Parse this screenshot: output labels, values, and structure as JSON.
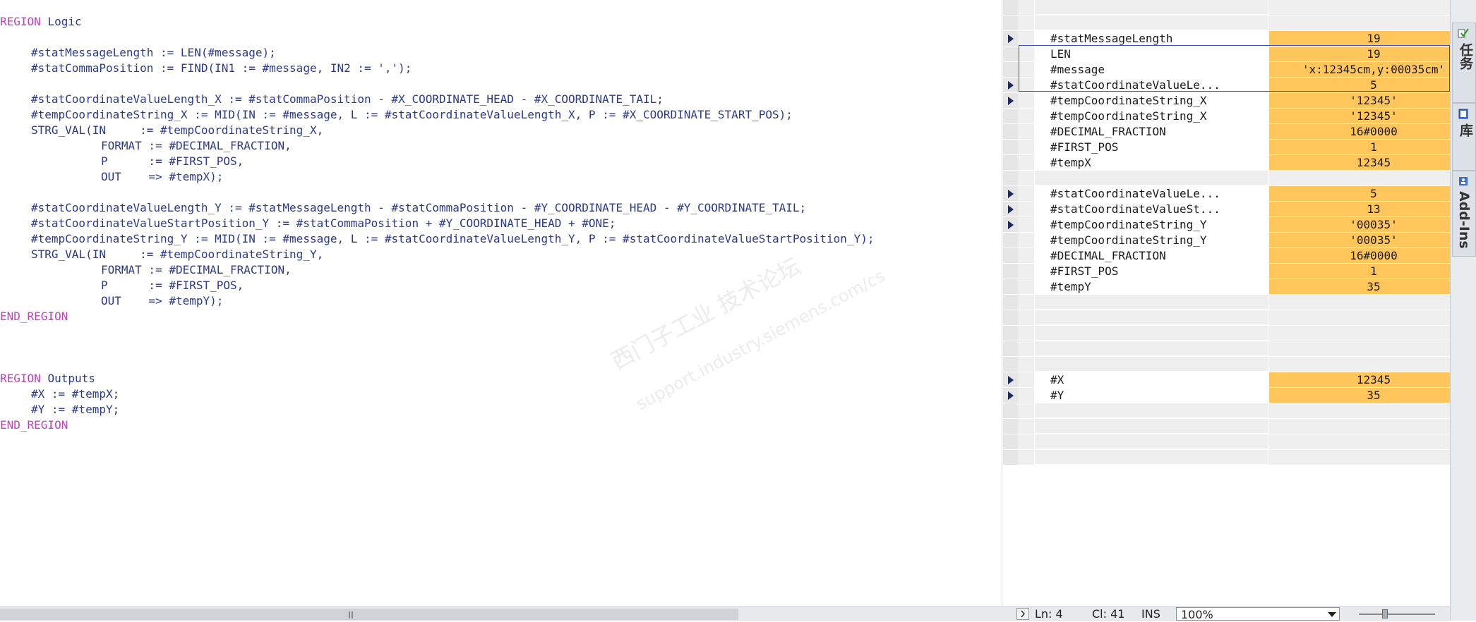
{
  "code": {
    "region_kw": "REGION",
    "end_region_kw": "END_REGION",
    "region_logic_name": "Logic",
    "region_outputs_name": "Outputs",
    "l_msg_len": "#statMessageLength := LEN(#message);",
    "l_comma_pos": "#statCommaPosition := FIND(IN1 := #message, IN2 := ',');",
    "l_cvl_x": "#statCoordinateValueLength_X := #statCommaPosition - #X_COORDINATE_HEAD - #X_COORDINATE_TAIL;",
    "l_tcs_x": "#tempCoordinateString_X := MID(IN := #message, L := #statCoordinateValueLength_X, P := #X_COORDINATE_START_POS);",
    "l_strg_x_1": "STRG_VAL(IN     := #tempCoordinateString_X,",
    "l_strg_x_2": "FORMAT := #DECIMAL_FRACTION,",
    "l_strg_x_3": "P      := #FIRST_POS,",
    "l_strg_x_4": "OUT    => #tempX);",
    "l_cvl_y": "#statCoordinateValueLength_Y := #statMessageLength - #statCommaPosition - #Y_COORDINATE_HEAD - #Y_COORDINATE_TAIL;",
    "l_cvsp_y": "#statCoordinateValueStartPosition_Y := #statCommaPosition + #Y_COORDINATE_HEAD + #ONE;",
    "l_tcs_y": "#tempCoordinateString_Y := MID(IN := #message, L := #statCoordinateValueLength_Y, P := #statCoordinateValueStartPosition_Y);",
    "l_strg_y_1": "STRG_VAL(IN     := #tempCoordinateString_Y,",
    "l_strg_y_2": "FORMAT := #DECIMAL_FRACTION,",
    "l_strg_y_3": "P      := #FIRST_POS,",
    "l_strg_y_4": "OUT    => #tempY);",
    "l_out_x": "#X := #tempX;",
    "l_out_y": "#Y := #tempY;"
  },
  "monitor": {
    "r2_name": "#statMessageLength",
    "r2_val": "19",
    "r3_name": "LEN",
    "r3_val": "19",
    "r4_name": "#message",
    "r4_val": "'x:12345cm,y:00035cm'",
    "r5_name": "#statCoordinateValueLe...",
    "r5_val": "5",
    "r6_name": "#tempCoordinateString_X",
    "r6_val": "'12345'",
    "r7_name": "#tempCoordinateString_X",
    "r7_val": "'12345'",
    "r8_name": "#DECIMAL_FRACTION",
    "r8_val": "16#0000",
    "r9_name": "#FIRST_POS",
    "r9_val": "1",
    "r10_name": "#tempX",
    "r10_val": "12345",
    "r12_name": "#statCoordinateValueLe...",
    "r12_val": "5",
    "r13_name": "#statCoordinateValueSt...",
    "r13_val": "13",
    "r14_name": "#tempCoordinateString_Y",
    "r14_val": "'00035'",
    "r15_name": "#tempCoordinateString_Y",
    "r15_val": "'00035'",
    "r16_name": "#DECIMAL_FRACTION",
    "r16_val": "16#0000",
    "r17_name": "#FIRST_POS",
    "r17_val": "1",
    "r18_name": "#tempY",
    "r18_val": "35",
    "r24_name": "#X",
    "r24_val": "12345",
    "r25_name": "#Y",
    "r25_val": "35"
  },
  "sidebar": {
    "tab_tasks": "任务",
    "tab_library": "库",
    "tab_addins": "Add-Ins"
  },
  "status": {
    "ln": "Ln: 4",
    "col": "Cl: 41",
    "mode": "INS",
    "zoom": "100%"
  },
  "watermark": {
    "line1": "西门子工业  技术论坛",
    "line2": "support.industry.siemens.com/cs"
  },
  "colors": {
    "keyword": "#c040c0",
    "code_text": "#2b3a8c",
    "monitor_value_bg": "#ffc65c",
    "selection_border": "#3c50c8"
  }
}
